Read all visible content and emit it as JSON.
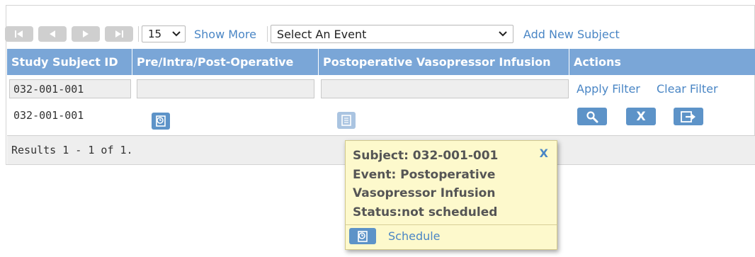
{
  "toolbar": {
    "page_size": "15",
    "show_more": "Show More",
    "event_select": "Select An Event",
    "add_new_subject": "Add New Subject"
  },
  "table": {
    "headers": [
      "Study Subject ID",
      "Pre/Intra/Post-Operative",
      "Postoperative Vasopressor Infusion",
      "Actions"
    ],
    "filter": {
      "subject_id": "032-001-001",
      "apply": "Apply Filter",
      "clear": "Clear Filter"
    },
    "rows": [
      {
        "subject_id": "032-001-001",
        "action_labels": [
          "",
          "X",
          ""
        ]
      }
    ],
    "results": "Results 1 - 1 of 1."
  },
  "popup": {
    "lines": [
      "Subject: 032-001-001",
      "Event: Postoperative",
      "Vasopressor Infusion",
      "Status:not scheduled"
    ],
    "close": "X",
    "schedule": "Schedule"
  },
  "colors": {
    "header_bg": "#7aa6d7",
    "accent_blue": "#5d93c8",
    "link": "#4a86c5",
    "popup_bg": "#fdf9cc",
    "nav_button": "#cfcfcf"
  },
  "icons": {
    "first": "first-page-icon",
    "prev": "prev-page-icon",
    "next": "next-page-icon",
    "last": "last-page-icon",
    "event_scheduled": "clock-doc-icon",
    "event_not_scheduled": "doc-icon",
    "view": "magnifier-icon",
    "remove": "remove-x-icon",
    "reassign": "reassign-icon"
  }
}
